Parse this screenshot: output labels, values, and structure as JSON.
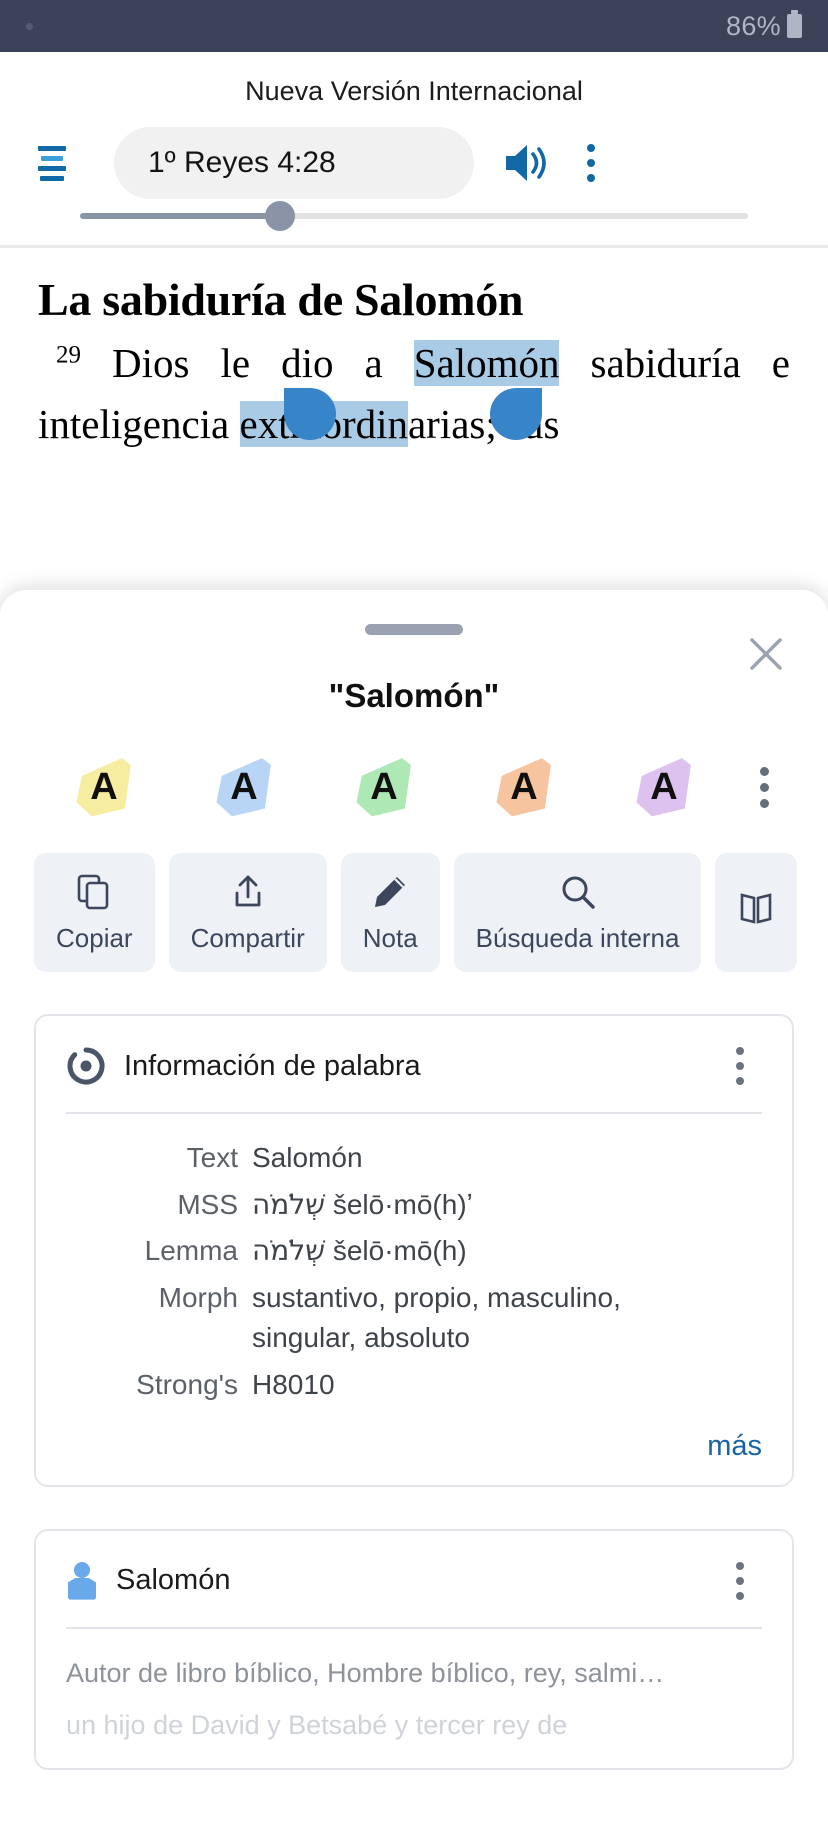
{
  "status_bar": {
    "battery_percent": "86%",
    "battery_icon": "battery-icon",
    "notification_dot": "notification-dot"
  },
  "header": {
    "version_title": "Nueva Versión Internacional",
    "menu_icon": "hamburger-menu-icon",
    "reference": "1º Reyes 4:28",
    "audio_icon": "speaker-volume-icon",
    "overflow_icon": "kebab-menu-icon",
    "progress_percent": 30
  },
  "scripture": {
    "heading": "La sabiduría de Salomón",
    "verse_number": "29",
    "verse_before": " Dios le dio a ",
    "verse_selected": "Salomón",
    "verse_after": " sabiduría",
    "line2_before": "e inteligencia ",
    "line2_selected": "extraordin",
    "line2_after": "arias;  sus"
  },
  "sheet": {
    "grabber": "drag-handle",
    "close_icon": "close-x-icon",
    "title": "\"Salomón\"",
    "highlights": [
      {
        "name": "highlight-yellow",
        "color": "#f7eda0",
        "letter": "A"
      },
      {
        "name": "highlight-blue",
        "color": "#b8d5f5",
        "letter": "A"
      },
      {
        "name": "highlight-green",
        "color": "#aee8b4",
        "letter": "A"
      },
      {
        "name": "highlight-orange",
        "color": "#f7c4a0",
        "letter": "A"
      },
      {
        "name": "highlight-purple",
        "color": "#ddc2f0",
        "letter": "A"
      }
    ],
    "highlight_overflow_icon": "kebab-menu-icon",
    "actions": [
      {
        "name": "copy",
        "icon": "copy-icon",
        "label": "Copiar"
      },
      {
        "name": "share",
        "icon": "share-icon",
        "label": "Compartir"
      },
      {
        "name": "note",
        "icon": "pencil-icon",
        "label": "Nota"
      },
      {
        "name": "internal-search",
        "icon": "search-icon",
        "label": "Búsqueda interna"
      },
      {
        "name": "more-action",
        "icon": "book-icon",
        "label": ""
      }
    ]
  },
  "word_info_card": {
    "icon": "logos-circle-icon",
    "title": "Información de palabra",
    "overflow_icon": "kebab-menu-icon",
    "rows": [
      {
        "key": "Text",
        "value": "Salomón",
        "hebrew": ""
      },
      {
        "key": "MSS",
        "value": "šelō·mō(h)ʼ",
        "hebrew": "שְׁלֹמֹה"
      },
      {
        "key": "Lemma",
        "value": "šelō·mō(h)",
        "hebrew": "שְׁלֹמֹה"
      },
      {
        "key": "Morph",
        "value": "sustantivo, propio, masculino, singular, absoluto",
        "hebrew": ""
      },
      {
        "key": "Strong's",
        "value": "H8010",
        "hebrew": ""
      }
    ],
    "more_label": "más"
  },
  "person_card": {
    "icon": "person-icon",
    "title": "Salomón",
    "overflow_icon": "kebab-menu-icon",
    "description": "Autor de libro bíblico, Hombre bíblico, rey, salmi…",
    "description_secondary": "un hijo de David y Betsabé y tercer rey de"
  },
  "colors": {
    "status_bar_bg": "#3c4358",
    "accent_blue": "#1168a7",
    "link_blue": "#1664a8",
    "selection_blue": "#aacbe6",
    "handle_blue": "#3884c9",
    "action_bg": "#eef1f6"
  }
}
